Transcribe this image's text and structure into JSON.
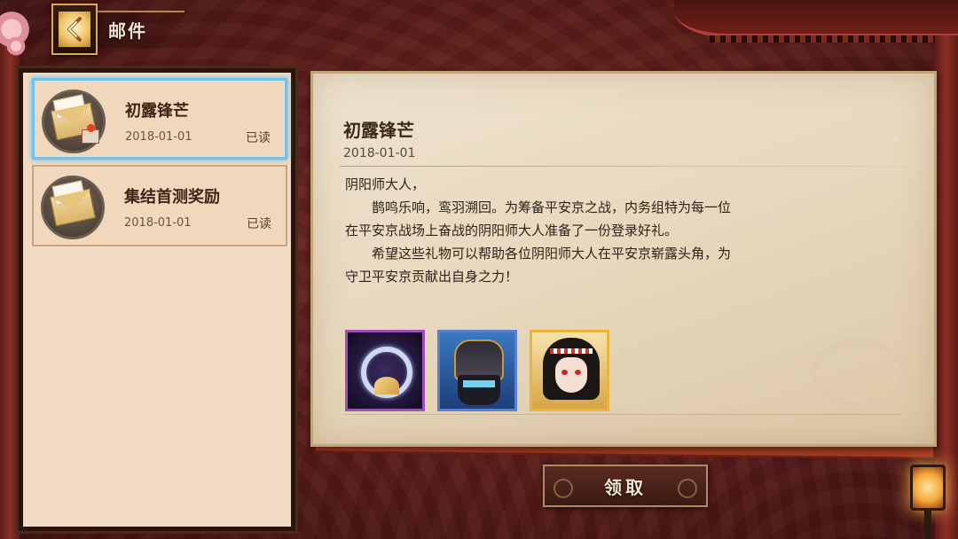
{
  "header": {
    "title": "邮件",
    "back_icon": "back-arrow-icon"
  },
  "mail_list": [
    {
      "title": "初露锋芒",
      "date": "2018-01-01",
      "status": "已读",
      "icon": "gift-envelope-icon",
      "selected": true
    },
    {
      "title": "集结首测奖励",
      "date": "2018-01-01",
      "status": "已读",
      "icon": "envelope-icon",
      "selected": false
    }
  ],
  "detail": {
    "title": "初露锋芒",
    "date": "2018-01-01",
    "greeting": "阴阳师大人，",
    "paragraph1_line1": "鹊鸣乐响，鸾羽溯回。为筹备平安京之战，内务组特为每一位",
    "paragraph1_line2": "在平安京战场上奋战的阴阳师大人准备了一份登录好礼。",
    "paragraph2_line1": "希望这些礼物可以帮助各位阴阳师大人在平安京崭露头角，为",
    "paragraph2_line2": "守卫平安京贡献出自身之力！",
    "rewards": [
      {
        "name": "ring-fan-item-icon",
        "frame": "#a04fb8"
      },
      {
        "name": "armored-warrior-icon",
        "frame": "#5b7fd0"
      },
      {
        "name": "shikigami-girl-portrait-icon",
        "frame": "#e8b53a"
      }
    ]
  },
  "claim_button": {
    "label": "领取"
  },
  "colors": {
    "selected_border": "#6ec2ee",
    "panel_bg": "#f1dcc3",
    "accent_gold": "#d9a955"
  }
}
